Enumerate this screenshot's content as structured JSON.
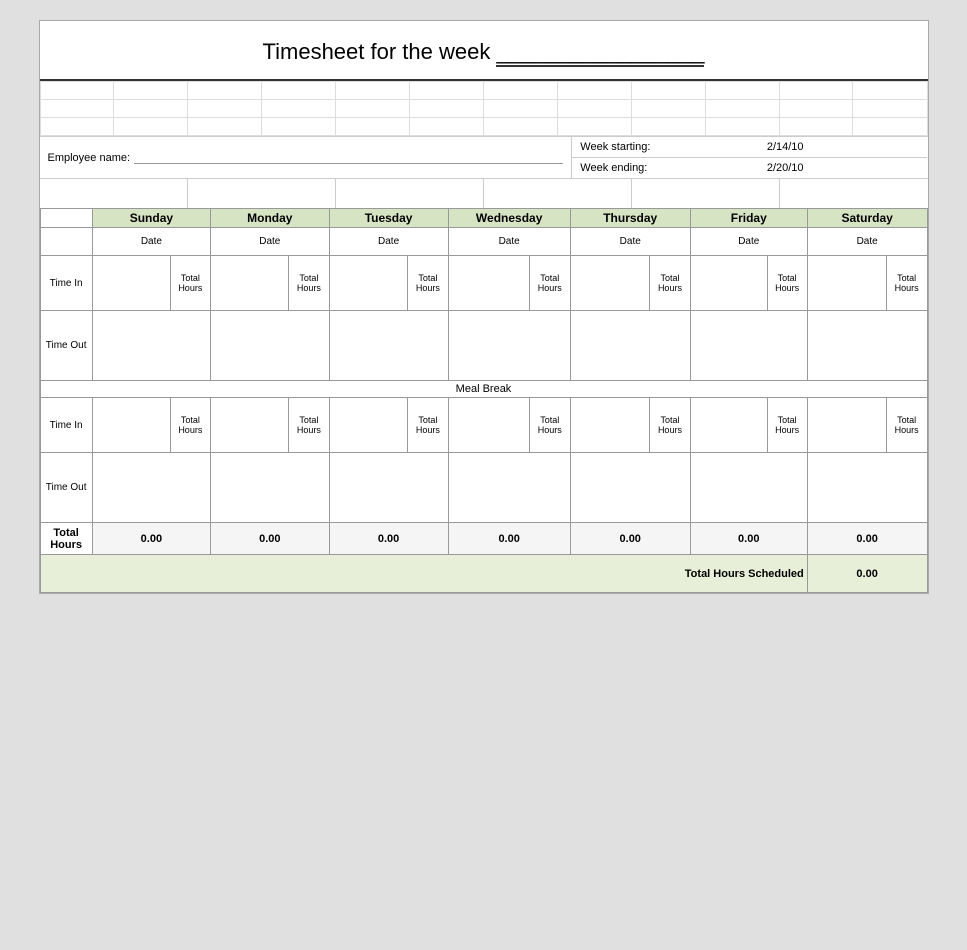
{
  "title": {
    "text": "Timesheet for the week",
    "line": "_________________"
  },
  "employee": {
    "label": "Employee name:",
    "value": ""
  },
  "week": {
    "starting_label": "Week starting:",
    "starting_value": "2/14/10",
    "ending_label": "Week ending:",
    "ending_value": "2/20/10"
  },
  "days": [
    {
      "label": "Sunday",
      "date_label": "Date"
    },
    {
      "label": "Monday",
      "date_label": "Date"
    },
    {
      "label": "Tuesday",
      "date_label": "Date"
    },
    {
      "label": "Wednesday",
      "date_label": "Date"
    },
    {
      "label": "Thursday",
      "date_label": "Date"
    },
    {
      "label": "Friday",
      "date_label": "Date"
    },
    {
      "label": "Saturday",
      "date_label": "Date"
    }
  ],
  "rows": {
    "time_in": "Time In",
    "time_out": "Time Out",
    "meal_break": "Meal Break",
    "total_hours": "Total Hours",
    "total_hours_label": "Total Hours",
    "hours_label": "Hours",
    "total_hours_scheduled": "Total Hours Scheduled"
  },
  "totals": {
    "sunday": "0.00",
    "monday": "0.00",
    "tuesday": "0.00",
    "wednesday": "0.00",
    "thursday": "0.00",
    "friday": "0.00",
    "saturday": "0.00",
    "scheduled": "0.00"
  }
}
